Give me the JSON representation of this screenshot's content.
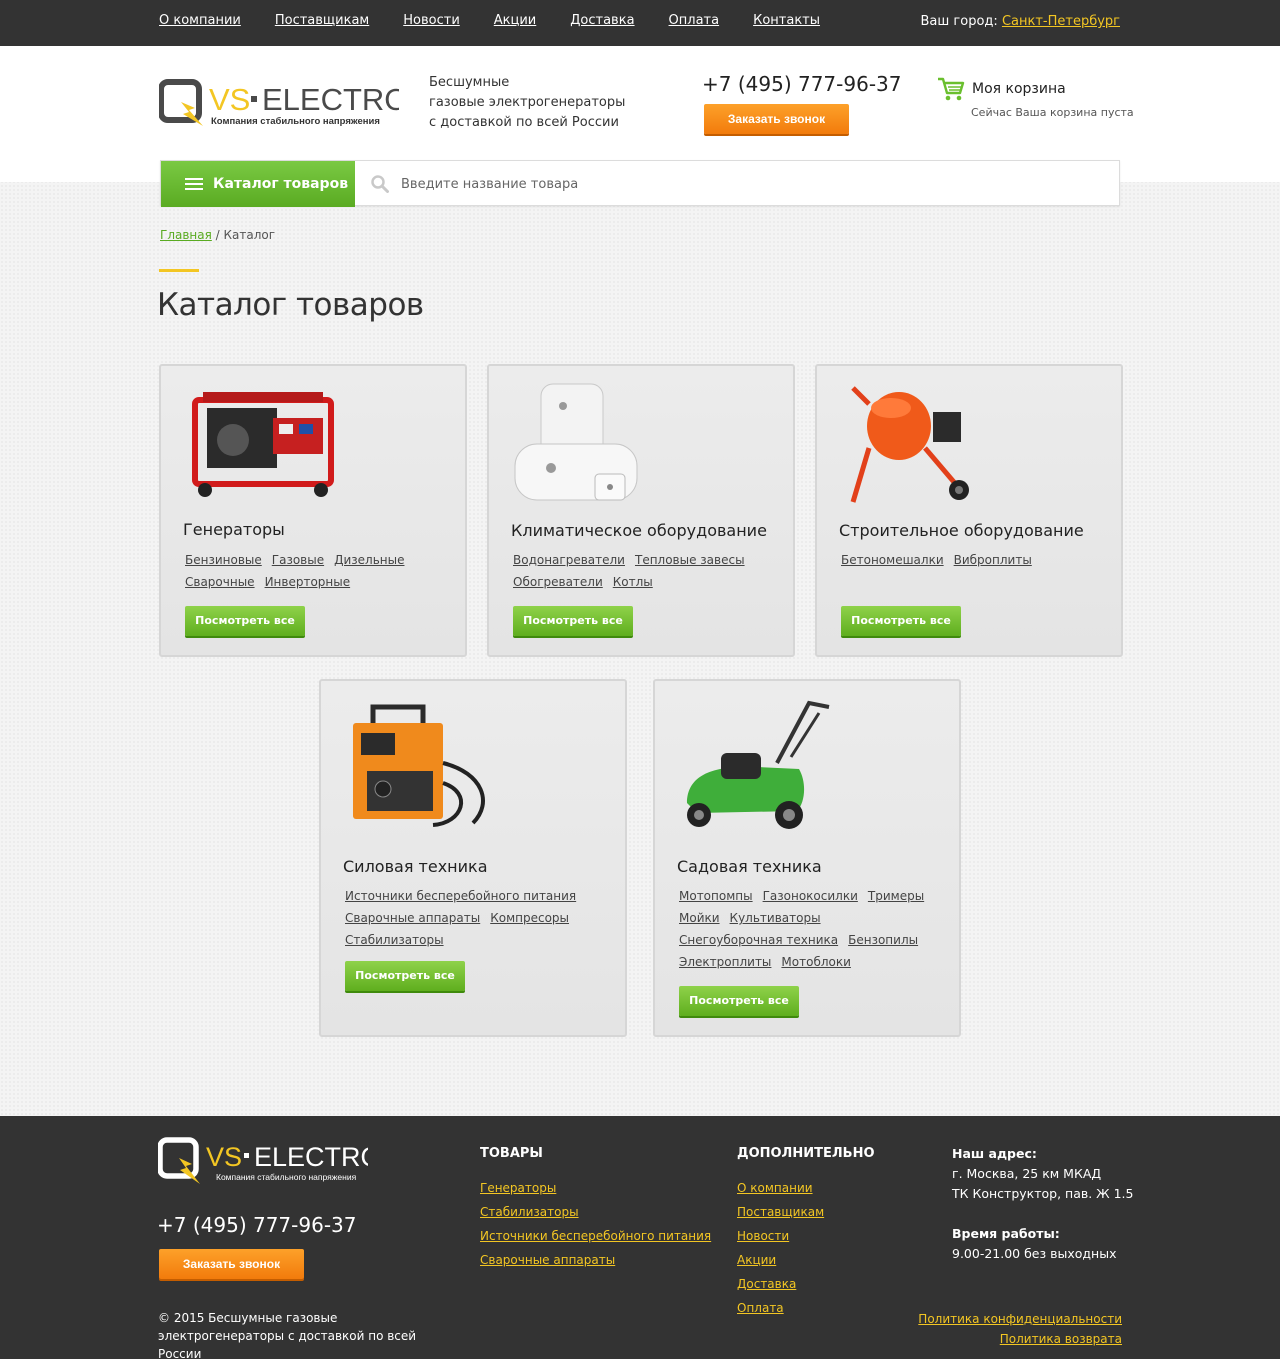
{
  "topnav": {
    "items": [
      "О компании",
      "Поставщикам",
      "Новости",
      "Акции",
      "Доставка",
      "Оплата",
      "Контакты"
    ],
    "city_label": "Ваш город:",
    "city_value": "Санкт-Петербург"
  },
  "header": {
    "logo_text_vs": "VS",
    "logo_text_electro": "ELECTRO",
    "logo_slogan": "Компания стабильного напряжения",
    "tagline": [
      "Бесшумные",
      "газовые электрогенераторы",
      "с доставкой по всей России"
    ],
    "phone": "+7 (495) 777-96-37",
    "call_button": "Заказать звонок",
    "cart_title": "Моя корзина",
    "cart_status": "Сейчас Ваша корзина пуста"
  },
  "catalog_bar": {
    "button_label": "Каталог товаров",
    "search_placeholder": "Введите название товара"
  },
  "breadcrumb": {
    "home": "Главная",
    "separator": " / ",
    "current": "Каталог"
  },
  "page_title": "Каталог товаров",
  "view_all_label": "Посмотреть все",
  "categories": [
    {
      "title": "Генераторы",
      "links": [
        [
          "Бензиновые",
          "Газовые",
          "Дизельные"
        ],
        [
          "Сварочные",
          "Инверторные"
        ]
      ]
    },
    {
      "title": "Климатическое оборудование",
      "links": [
        [
          "Водонагреватели",
          "Тепловые завесы"
        ],
        [
          "Обогреватели",
          "Котлы"
        ]
      ]
    },
    {
      "title": "Строительное оборудование",
      "links": [
        [
          "Бетономешалки",
          "Виброплиты"
        ]
      ]
    },
    {
      "title": "Силовая техника",
      "links": [
        [
          "Источники бесперебойного питания"
        ],
        [
          "Сварочные аппараты",
          "Компресоры"
        ],
        [
          "Стабилизаторы"
        ]
      ]
    },
    {
      "title": "Садовая техника",
      "links": [
        [
          "Мотопомпы",
          "Газонокосилки",
          "Тримеры"
        ],
        [
          "Мойки",
          "Культиваторы"
        ],
        [
          "Снегоуборочная техника",
          "Бензопилы"
        ],
        [
          "Электроплиты",
          "Мотоблоки"
        ]
      ]
    }
  ],
  "footer": {
    "phone": "+7 (495) 777-96-37",
    "call_button": "Заказать звонок",
    "copyright": "© 2015 Бесшумные газовые электрогенераторы с доставкой по всей России",
    "goods_title": "ТОВАРЫ",
    "goods_links": [
      "Генераторы",
      "Стабилизаторы",
      "Источники бесперебойного питания",
      "Сварочные аппараты"
    ],
    "extra_title": "ДОПОЛНИТЕЛЬНО",
    "extra_links": [
      "О компании",
      "Поставщикам",
      "Новости",
      "Акции",
      "Доставка",
      "Оплата"
    ],
    "address_label": "Наш адрес:",
    "address_lines": [
      "г. Москва, 25 км МКАД",
      "ТК Конструктор, пав. Ж 1.5"
    ],
    "hours_label": "Время работы:",
    "hours": "9.00-21.00 без выходных",
    "legal_links": [
      "Политика конфиденциальности",
      "Политика возврата"
    ]
  },
  "colors": {
    "accent_yellow": "#f3c623",
    "brand_green": "#5aab22",
    "orange": "#f27b0c",
    "dark": "#333333"
  }
}
